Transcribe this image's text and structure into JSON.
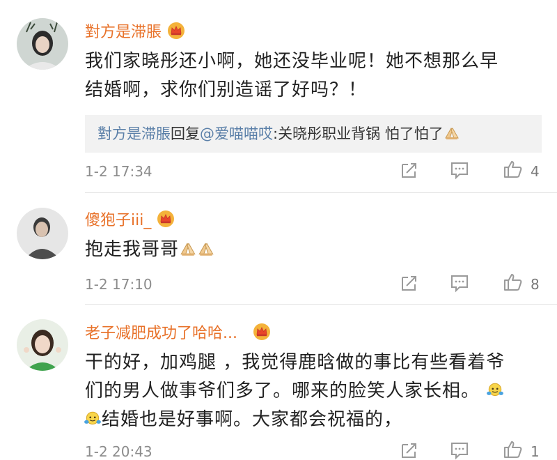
{
  "comments": [
    {
      "username": "對方是滞脹",
      "text_line1": "我们家晓彤还小啊，她还没毕业呢！她不想那么早",
      "text_line2": "结婚啊，求你们别造谣了好吗？！",
      "reply": {
        "author": "對方是滞脹",
        "verb": "回复",
        "mention": "@爱喵喵哎",
        "text": ":关晓彤职业背锅 怕了怕了"
      },
      "timestamp": "1-2 17:34",
      "likes": "4"
    },
    {
      "username": "傻狍子iii_",
      "text_line1": "抱走我哥哥",
      "timestamp": "1-2 17:10",
      "likes": "8"
    },
    {
      "username": "老子减肥成功了哈哈...",
      "text_line1": "干的好，加鸡腿 ，我觉得鹿晗做的事比有些看着爷",
      "text_line2": "们的男人做事爷们多了。哪来的脸笑人家长相。",
      "text_line3": "结婚也是好事啊。大家都会祝福的，",
      "timestamp": "1-2 20:43",
      "likes": "1"
    }
  ],
  "icons": {
    "share": "share-icon",
    "comment": "comment-icon",
    "like": "thumbs-up-icon",
    "crown": "crown-icon",
    "emoji_pray": "pray-hands-emoji",
    "emoji_face": "face-emoji"
  },
  "colors": {
    "username": "#e8722a",
    "reply_name": "#5a7fa8",
    "meta": "#8c8c8c",
    "reply_bg": "#f2f2f2"
  }
}
